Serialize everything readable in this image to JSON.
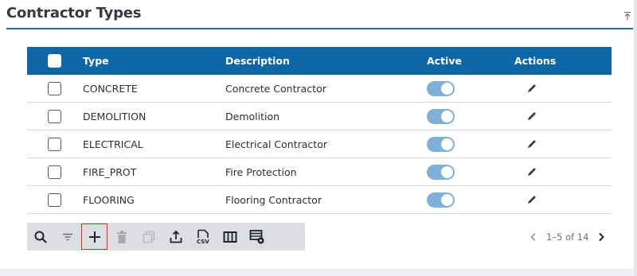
{
  "panel": {
    "title": "Contractor Types"
  },
  "grid": {
    "columns": {
      "type": "Type",
      "description": "Description",
      "active": "Active",
      "actions": "Actions"
    },
    "rows": [
      {
        "type": "CONCRETE",
        "description": "Concrete Contractor",
        "active": true
      },
      {
        "type": "DEMOLITION",
        "description": "Demolition",
        "active": true
      },
      {
        "type": "ELECTRICAL",
        "description": "Electrical Contractor",
        "active": true
      },
      {
        "type": "FIRE_PROT",
        "description": "Fire Protection",
        "active": true
      },
      {
        "type": "FLOORING",
        "description": "Flooring Contractor",
        "active": true
      }
    ]
  },
  "toolbar": {
    "buttons": [
      "search-icon",
      "filter-icon",
      "add-icon",
      "delete-icon",
      "copy-icon",
      "export-icon",
      "csv-icon",
      "columns-icon",
      "grid-settings-icon"
    ]
  },
  "pager": {
    "range": "1–5 of 14"
  },
  "colors": {
    "header": "#0f66a6",
    "toggle_on": "#7fb0d9",
    "accent_rule": "#2f6fa8",
    "selected_outline": "#d0312d"
  }
}
